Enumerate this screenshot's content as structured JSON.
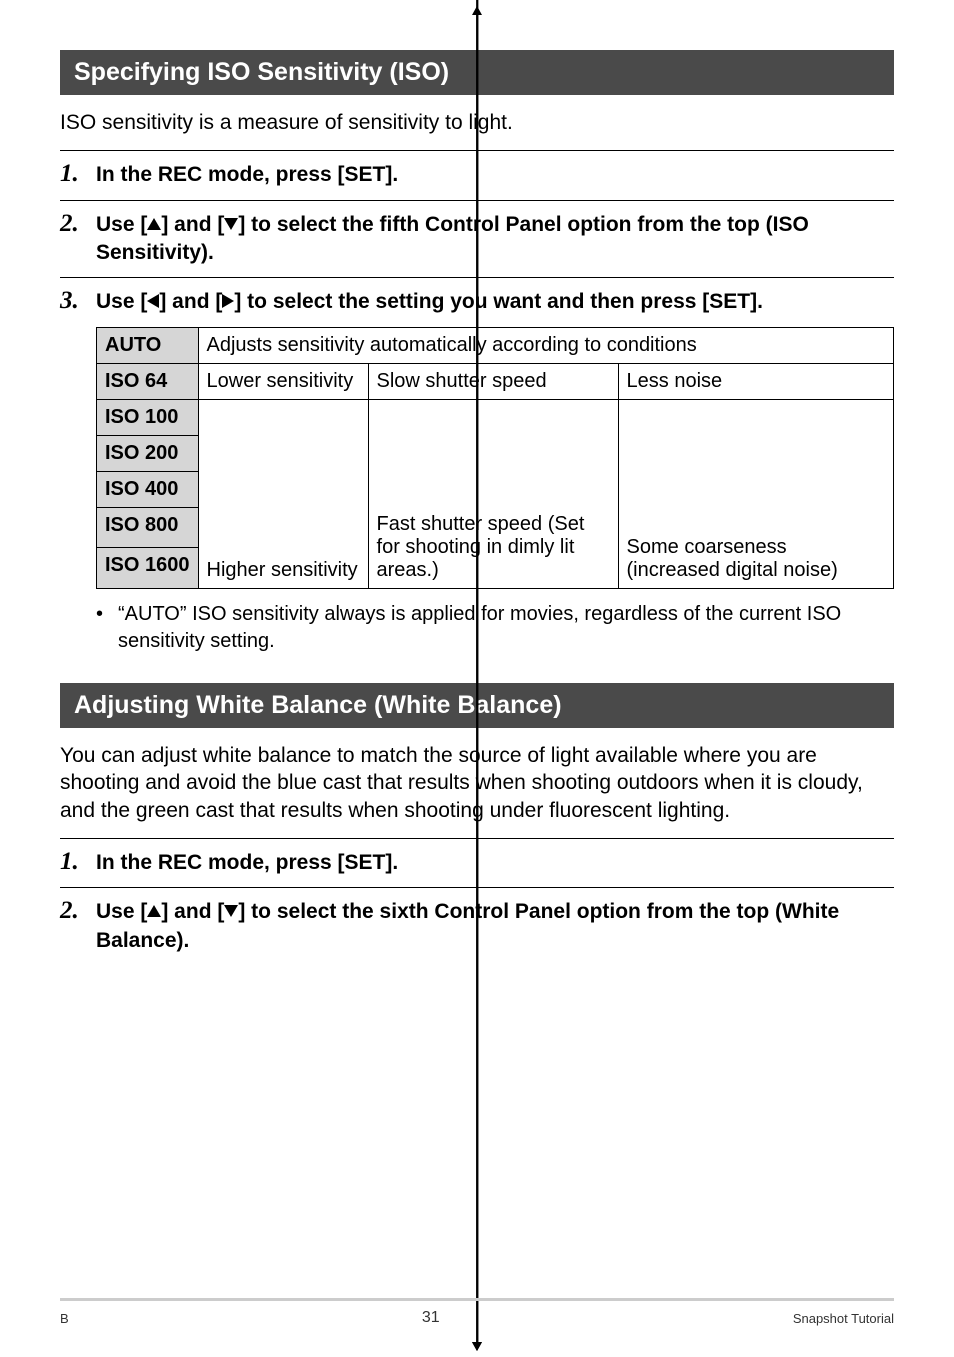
{
  "sections": {
    "iso_title": "Specifying ISO Sensitivity (ISO)",
    "iso_intro": "ISO sensitivity is a measure of sensitivity to light.",
    "wb_title": "Adjusting White Balance (White Balance)",
    "wb_intro": "You can adjust white balance to match the source of light available where you are shooting and avoid the blue cast that results when shooting outdoors when it is cloudy, and the green cast that results when shooting under fluorescent lighting."
  },
  "iso_steps": {
    "s1": "In the REC mode, press [SET].",
    "s2_a": "Use [",
    "s2_b": "] and [",
    "s2_c": "] to select the fifth Control Panel option from the top (ISO Sensitivity).",
    "s3_a": "Use [",
    "s3_b": "] and [",
    "s3_c": "] to select the setting you want and then press [SET]."
  },
  "wb_steps": {
    "s1": "In the REC mode, press [SET].",
    "s2_a": "Use [",
    "s2_b": "] and [",
    "s2_c": "] to select the sixth Control Panel option from the top (White Balance)."
  },
  "iso_table": {
    "rows": {
      "auto": "AUTO",
      "iso64": "ISO 64",
      "iso100": "ISO 100",
      "iso200": "ISO 200",
      "iso400": "ISO 400",
      "iso800": "ISO 800",
      "iso1600": "ISO 1600"
    },
    "auto_desc": "Adjusts sensitivity automatically according to conditions",
    "col1_top": "Lower sensitivity",
    "col1_bottom": "Higher sensitivity",
    "col2_top": "Slow shutter speed",
    "col2_bottom": "Fast shutter speed (Set for shooting in dimly lit areas.)",
    "col3_top": "Less noise",
    "col3_bottom": "Some coarseness (increased digital noise)"
  },
  "bullet": "“AUTO” ISO sensitivity always is applied for movies, regardless of the current ISO sensitivity setting.",
  "footer": {
    "left": "B",
    "center": "31",
    "right": "Snapshot Tutorial"
  }
}
